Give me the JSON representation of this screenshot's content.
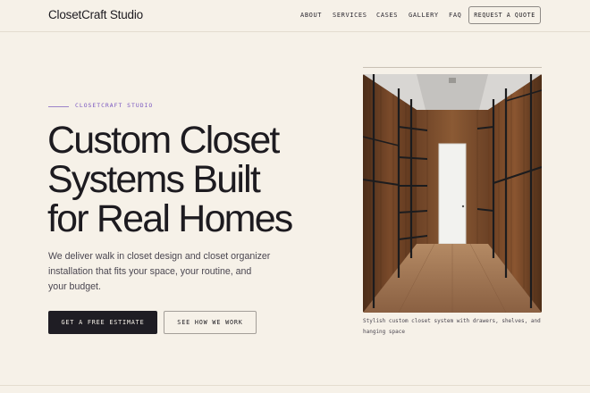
{
  "header": {
    "brand": "ClosetCraft Studio",
    "nav": {
      "about": "ABOUT",
      "services": "SERVICES",
      "cases": "CASES",
      "gallery": "GALLERY",
      "faq": "FAQ"
    },
    "cta": "REQUEST A QUOTE"
  },
  "hero": {
    "eyebrow": "CLOSETCRAFT STUDIO",
    "title_lines": [
      "Custom Closet",
      "Systems Built",
      "for Real Homes"
    ],
    "description": "We deliver walk in closet design and closet organizer installation that fits your space, your routine, and your budget.",
    "primary_button": "GET A FREE ESTIMATE",
    "secondary_button": "SEE HOW WE WORK"
  },
  "media": {
    "image_icon": "walk-in-closet-photo",
    "caption": "Stylish custom closet system with drawers, shelves, and hanging space"
  },
  "colors": {
    "background": "#f6f1e8",
    "ink": "#1d1b20",
    "accent": "#7a57c0",
    "wood": "#6b4428"
  }
}
